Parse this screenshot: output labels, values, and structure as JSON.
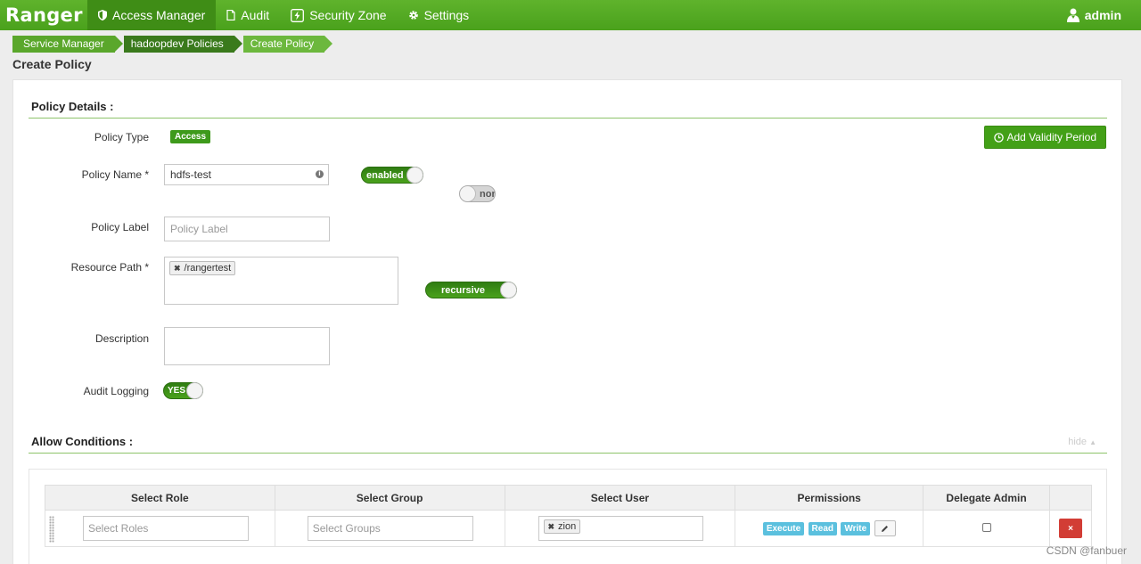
{
  "nav": {
    "brand": "Ranger",
    "items": [
      {
        "label": "Access Manager",
        "icon": "shield-icon"
      },
      {
        "label": "Audit",
        "icon": "file-icon"
      },
      {
        "label": "Security Zone",
        "icon": "bolt-icon"
      },
      {
        "label": "Settings",
        "icon": "gear-icon"
      }
    ],
    "user": "admin"
  },
  "breadcrumb": [
    "Service Manager",
    "hadoopdev Policies",
    "Create Policy"
  ],
  "page_title": "Create Policy",
  "policy_details": {
    "title": "Policy Details :",
    "policy_type_label": "Policy Type",
    "policy_type_value": "Access",
    "add_validity_label": "Add Validity Period",
    "policy_name_label": "Policy Name *",
    "policy_name_value": "hdfs-test",
    "enabled_toggle": "enabled",
    "normal_toggle": "nor",
    "policy_label_label": "Policy Label",
    "policy_label_placeholder": "Policy Label",
    "resource_path_label": "Resource Path *",
    "resource_path_chip": "/rangertest",
    "recursive_toggle": "recursive",
    "description_label": "Description",
    "audit_logging_label": "Audit Logging",
    "audit_logging_value": "YES"
  },
  "allow_conditions": {
    "title": "Allow Conditions :",
    "hide_label": "hide",
    "columns": [
      "Select Role",
      "Select Group",
      "Select User",
      "Permissions",
      "Delegate Admin",
      ""
    ],
    "row": {
      "role_placeholder": "Select Roles",
      "group_placeholder": "Select Groups",
      "user_chip": "zion",
      "permissions": [
        "Execute",
        "Read",
        "Write"
      ],
      "delete_label": "×"
    }
  },
  "watermark": "CSDN @fanbuer",
  "colors": {
    "brand_green": "#4aa11c",
    "perm_badge": "#5bc0de",
    "delete_red": "#d23d35"
  }
}
